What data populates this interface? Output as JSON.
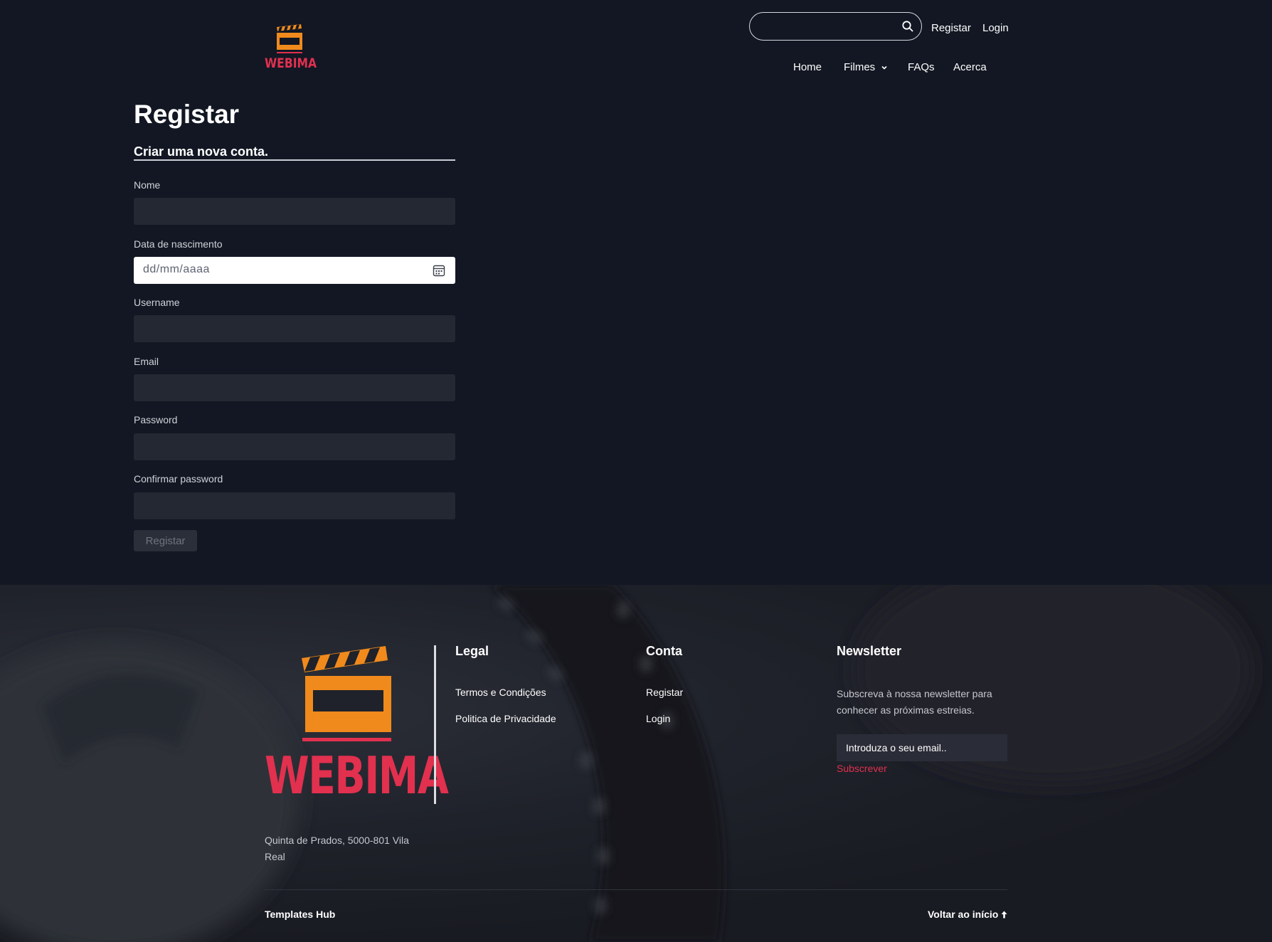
{
  "header": {
    "brand": "WEBIMA",
    "search": {
      "value": "",
      "placeholder": ""
    },
    "top_links": {
      "register": "Registar",
      "login": "Login"
    },
    "nav": {
      "home": "Home",
      "movies": "Filmes",
      "faqs": "FAQs",
      "about": "Acerca"
    }
  },
  "form": {
    "title": "Registar",
    "subtitle": "Criar uma nova conta.",
    "fields": {
      "name": {
        "label": "Nome",
        "value": ""
      },
      "birthdate": {
        "label": "Data de nascimento",
        "placeholder": "dd/mm/aaaa"
      },
      "username": {
        "label": "Username",
        "value": ""
      },
      "email": {
        "label": "Email",
        "value": ""
      },
      "password": {
        "label": "Password",
        "value": ""
      },
      "confirm_password": {
        "label": "Confirmar password",
        "value": ""
      }
    },
    "submit_label": "Registar"
  },
  "footer": {
    "brand": "WEBIMA",
    "address": "Quinta de Prados, 5000-801 Vila Real",
    "legal": {
      "heading": "Legal",
      "terms": "Termos e Condições",
      "privacy": "Politica de Privacidade"
    },
    "account": {
      "heading": "Conta",
      "register": "Registar",
      "login": "Login"
    },
    "newsletter": {
      "heading": "Newsletter",
      "text": "Subscreva à nossa newsletter para conhecer as próximas estreias.",
      "email_placeholder": "Introduza o seu email..",
      "subscribe": "Subscrever"
    },
    "credit": "Templates Hub",
    "back_to_top": "Voltar ao início"
  },
  "colors": {
    "background": "#121723",
    "brand_orange": "#f08a1c",
    "brand_red": "#e2304f",
    "input_dark": "#242833"
  },
  "icons": [
    "clapperboard-logo-icon",
    "search-icon",
    "chevron-down-icon",
    "calendar-icon",
    "arrow-up-icon"
  ]
}
